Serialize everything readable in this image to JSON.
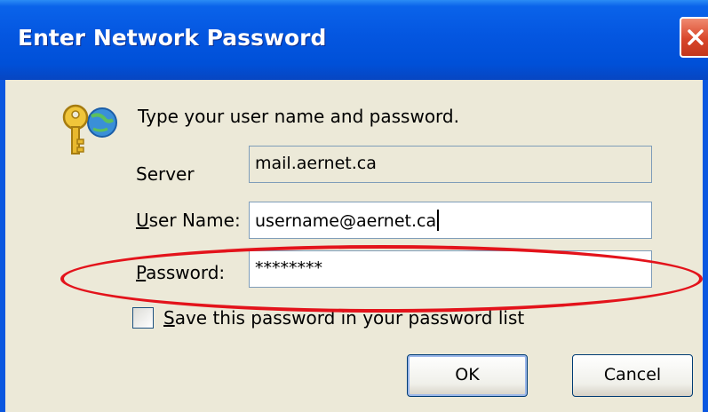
{
  "window": {
    "title": "Enter Network Password",
    "close_label": "Close"
  },
  "prompt": "Type your user name and password.",
  "server": {
    "label": "Server",
    "value": "mail.aernet.ca"
  },
  "username": {
    "label_accel": "U",
    "label_rest": "ser Name:",
    "value": "username@aernet.ca"
  },
  "password": {
    "label_accel": "P",
    "label_rest": "assword:",
    "value": "********"
  },
  "save_password": {
    "label_accel": "S",
    "label_rest": "ave this password in your password list",
    "checked": false
  },
  "buttons": {
    "ok": "OK",
    "cancel": "Cancel"
  },
  "icons": {
    "close": "close-icon",
    "key": "key-globe-icon"
  },
  "colors": {
    "titlebar": "#0456e0",
    "close_button": "#d8462a",
    "dialog_face": "#ece9d8",
    "annotation": "#e3131b"
  }
}
